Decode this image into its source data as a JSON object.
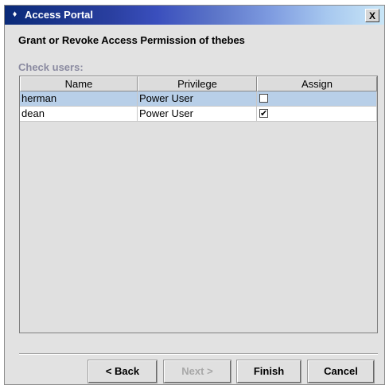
{
  "window": {
    "title": "Access Portal",
    "close_label": "X"
  },
  "heading": "Grant or Revoke Access Permission of  thebes",
  "section_label": "Check users:",
  "table": {
    "columns": [
      "Name",
      "Privilege",
      "Assign"
    ],
    "rows": [
      {
        "name": "herman",
        "privilege": "Power User",
        "assign": false,
        "selected": true
      },
      {
        "name": "dean",
        "privilege": "Power User",
        "assign": true,
        "selected": false
      }
    ]
  },
  "buttons": {
    "back": "< Back",
    "next": "Next >",
    "finish": "Finish",
    "cancel": "Cancel"
  },
  "icons": {
    "title_icon": "access-portal-icon"
  },
  "colors": {
    "title_gradient_start": "#0a2a78",
    "selected_row": "#b8cfe8",
    "section_label": "#8a8aa0"
  }
}
